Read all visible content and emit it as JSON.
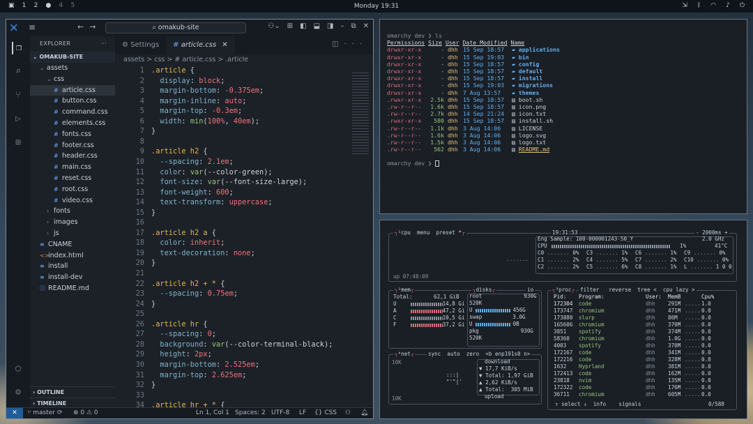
{
  "topbar": {
    "workspaces": [
      "1",
      "2",
      "4",
      "5"
    ],
    "clock": "Monday 19:31"
  },
  "vscode": {
    "search": "omakub-site",
    "explorer_title": "EXPLORER",
    "project": "OMAKUB-SITE",
    "tree": [
      {
        "label": "assets",
        "kind": "folder-open",
        "depth": 1
      },
      {
        "label": "css",
        "kind": "folder-open",
        "depth": 2
      },
      {
        "label": "article.css",
        "kind": "css",
        "depth": 3,
        "selected": true
      },
      {
        "label": "button.css",
        "kind": "css",
        "depth": 3
      },
      {
        "label": "command.css",
        "kind": "css",
        "depth": 3
      },
      {
        "label": "elements.css",
        "kind": "css",
        "depth": 3
      },
      {
        "label": "fonts.css",
        "kind": "css",
        "depth": 3
      },
      {
        "label": "footer.css",
        "kind": "css",
        "depth": 3
      },
      {
        "label": "header.css",
        "kind": "css",
        "depth": 3
      },
      {
        "label": "main.css",
        "kind": "css",
        "depth": 3
      },
      {
        "label": "reset.css",
        "kind": "css",
        "depth": 3
      },
      {
        "label": "root.css",
        "kind": "css",
        "depth": 3
      },
      {
        "label": "video.css",
        "kind": "css",
        "depth": 3
      },
      {
        "label": "fonts",
        "kind": "folder",
        "depth": 2
      },
      {
        "label": "images",
        "kind": "folder",
        "depth": 2
      },
      {
        "label": "js",
        "kind": "folder",
        "depth": 2
      },
      {
        "label": "CNAME",
        "kind": "file",
        "depth": 1
      },
      {
        "label": "index.html",
        "kind": "html",
        "depth": 1
      },
      {
        "label": "install",
        "kind": "file",
        "depth": 1
      },
      {
        "label": "install-dev",
        "kind": "file",
        "depth": 1
      },
      {
        "label": "README.md",
        "kind": "info",
        "depth": 1
      }
    ],
    "outline": "OUTLINE",
    "timeline": "TIMELINE",
    "tabs": [
      {
        "label": "Settings"
      },
      {
        "label": "article.css",
        "active": true
      }
    ],
    "breadcrumb": "assets > css > # article.css > .article",
    "code": [
      [
        1,
        ".article {"
      ],
      [
        2,
        "  display: block;"
      ],
      [
        3,
        "  margin-bottom: -0.375em;"
      ],
      [
        4,
        "  margin-inline: auto;"
      ],
      [
        5,
        "  margin-top: -0.3em;"
      ],
      [
        6,
        "  width: min(100%, 40em);"
      ],
      [
        7,
        "}"
      ],
      [
        8,
        ""
      ],
      [
        9,
        ".article h2 {"
      ],
      [
        10,
        "  --spacing: 2.1em;"
      ],
      [
        11,
        "  color: var(--color-green);"
      ],
      [
        12,
        "  font-size: var(--font-size-large);"
      ],
      [
        13,
        "  font-weight: 600;"
      ],
      [
        14,
        "  text-transform: uppercase;"
      ],
      [
        15,
        "}"
      ],
      [
        16,
        ""
      ],
      [
        17,
        ".article h2 a {"
      ],
      [
        18,
        "  color: inherit;"
      ],
      [
        19,
        "  text-decoration: none;"
      ],
      [
        20,
        "}"
      ],
      [
        21,
        ""
      ],
      [
        22,
        ".article h2 + * {"
      ],
      [
        23,
        "  --spacing: 0.75em;"
      ],
      [
        24,
        "}"
      ],
      [
        25,
        ""
      ],
      [
        26,
        ".article hr {"
      ],
      [
        27,
        "  --spacing: 0;"
      ],
      [
        28,
        "  background: var(--color-terminal-black);"
      ],
      [
        29,
        "  height: 2px;"
      ],
      [
        30,
        "  margin-bottom: 2.525em;"
      ],
      [
        31,
        "  margin-top: 2.625em;"
      ],
      [
        32,
        "}"
      ],
      [
        33,
        ""
      ],
      [
        34,
        ".article hr + * {"
      ]
    ],
    "status": {
      "branch": "master",
      "problems": "⊗ 0 ⚠ 0",
      "position": "Ln 1, Col 1",
      "spaces": "Spaces: 2",
      "encoding": "UTF-8",
      "eol": "LF",
      "lang": "{} CSS"
    }
  },
  "terminal": {
    "prompt1": "omarchy dev ❯ ls",
    "headers": [
      "Permissions",
      "Size",
      "User",
      "Date Modified",
      "Name"
    ],
    "rows": [
      [
        "drwxr-xr-x",
        "-",
        "dhh",
        "15 Sep 18:57",
        "applications",
        "dir"
      ],
      [
        "drwxr-xr-x",
        "-",
        "dhh",
        "15 Sep 19:03",
        "bin",
        "dir"
      ],
      [
        "drwxr-xr-x",
        "-",
        "dhh",
        "15 Sep 18:57",
        "config",
        "dir"
      ],
      [
        "drwxr-xr-x",
        "-",
        "dhh",
        "15 Sep 18:57",
        "default",
        "dir"
      ],
      [
        "drwxr-xr-x",
        "-",
        "dhh",
        "15 Sep 18:57",
        "install",
        "dir"
      ],
      [
        "drwxr-xr-x",
        "-",
        "dhh",
        "15 Sep 19:03",
        "migrations",
        "dir"
      ],
      [
        "drwxr-xr-x",
        "-",
        "dhh",
        "7 Aug 13:57",
        "themes",
        "dir"
      ],
      [
        ".rwxr-xr-x",
        "2.5k",
        "dhh",
        "15 Sep 18:57",
        "boot.sh",
        "file"
      ],
      [
        ".rw-r--r--",
        "1.6k",
        "dhh",
        "15 Sep 18:57",
        "icon.png",
        "file"
      ],
      [
        ".rw-r--r--",
        "2.7k",
        "dhh",
        "14 Sep 21:24",
        "icon.txt",
        "file"
      ],
      [
        ".rwxr-xr-x",
        "580",
        "dhh",
        "15 Sep 18:57",
        "install.sh",
        "file"
      ],
      [
        ".rw-r--r--",
        "1.1k",
        "dhh",
        "3 Aug 14:06",
        "LICENSE",
        "file"
      ],
      [
        ".rw-r--r--",
        "1.6k",
        "dhh",
        "3 Aug 14:06",
        "logo.svg",
        "file"
      ],
      [
        ".rw-r--r--",
        "1.5k",
        "dhh",
        "3 Aug 14:06",
        "logo.txt",
        "file"
      ],
      [
        ".rw-r--r--",
        "562",
        "dhh",
        "3 Aug 14:06",
        "README.md",
        "readme"
      ]
    ],
    "prompt2": "omarchy dev ❯"
  },
  "btop": {
    "cpu_tabs": "¹cpu  menu  preset *",
    "time": "19:31:53",
    "interval": "- 2000ms +",
    "engine": "Eng Sample: 100-000001243-50_Y",
    "freq": "2.0 GHz",
    "cpu_total": {
      "label": "CPU",
      "pct": "1%",
      "temp": "41°C"
    },
    "cores": [
      [
        "C0",
        "0%"
      ],
      [
        "C1",
        "2%"
      ],
      [
        "C2",
        "2%"
      ],
      [
        "C3",
        "1%"
      ],
      [
        "C4",
        "5%"
      ],
      [
        "C5",
        "6%"
      ],
      [
        "C6",
        "1%"
      ],
      [
        "C7",
        "2%"
      ],
      [
        "C8",
        "1%"
      ],
      [
        "C9",
        "0%"
      ],
      [
        "C10",
        "0%"
      ],
      [
        "L",
        "1 0 0"
      ]
    ],
    "uptime": "up 07:48:09",
    "mem_title": "²mem",
    "disks_title": "disks",
    "io": "io",
    "mem": {
      "total_label": "Total:",
      "total": "62,1 GiB",
      "rows": [
        [
          "U",
          "14,8 Gi"
        ],
        [
          "A",
          "47,2 Gi"
        ],
        [
          "C",
          "10,5 Gi"
        ],
        [
          "F",
          "37,2 Gi"
        ]
      ]
    },
    "disks": [
      [
        "root",
        "930G"
      ],
      [
        "520K",
        ""
      ],
      [
        "U",
        "456G"
      ],
      [
        "swap",
        "3.0G"
      ],
      [
        "U",
        "0B"
      ],
      [
        "pkg",
        "930G"
      ],
      [
        "520K",
        ""
      ]
    ],
    "net_title": "⁴net",
    "net_tabs": "sync  auto  zero  <b enp191s0 n>",
    "net_scale": "10K",
    "net": {
      "download": "download",
      "dl_rate": "17,7 KiB/s",
      "dl_total": "Total: 1,97 GiB",
      "ul_rate": "2,62 KiB/s",
      "ul_total": "Total:  305 MiB",
      "upload": "upload"
    },
    "proc_title": "³proc",
    "proc_tabs": "filter   reverse  tree <  cpu lazy >",
    "proc_headers": [
      "Pid:",
      "Program:",
      "User:",
      "MemB",
      "Cpu%"
    ],
    "procs": [
      [
        "172304",
        "code",
        "dhh",
        "291M",
        "1.0"
      ],
      [
        "173747",
        "chromium",
        "dhh",
        "471M",
        "0.0"
      ],
      [
        "173880",
        "slurp",
        "dhh",
        "86M",
        "0.0"
      ],
      [
        "165606",
        "chromium",
        "dhh",
        "370M",
        "0.0"
      ],
      [
        "3851",
        "spotify",
        "dhh",
        "374M",
        "0.0"
      ],
      [
        "58360",
        "chromium",
        "dhh",
        "1.0G",
        "0.0"
      ],
      [
        "4003",
        "spotify",
        "dhh",
        "370M",
        "0.0"
      ],
      [
        "172167",
        "code",
        "dhh",
        "341M",
        "0.0"
      ],
      [
        "172216",
        "code",
        "dhh",
        "328M",
        "0.0"
      ],
      [
        "1632",
        "Hyprland",
        "dhh",
        "381M",
        "0.0"
      ],
      [
        "172413",
        "code",
        "dhh",
        "162M",
        "0.0"
      ],
      [
        "23818",
        "nvim",
        "dhh",
        "135M",
        "0.0"
      ],
      [
        "172322",
        "code",
        "dhh",
        "176M",
        "0.0"
      ],
      [
        "36711",
        "chromium",
        "dhh",
        "605M",
        "0.0"
      ]
    ],
    "proc_footer": "↑ select ↓  info    signals",
    "proc_count": "0/588"
  }
}
